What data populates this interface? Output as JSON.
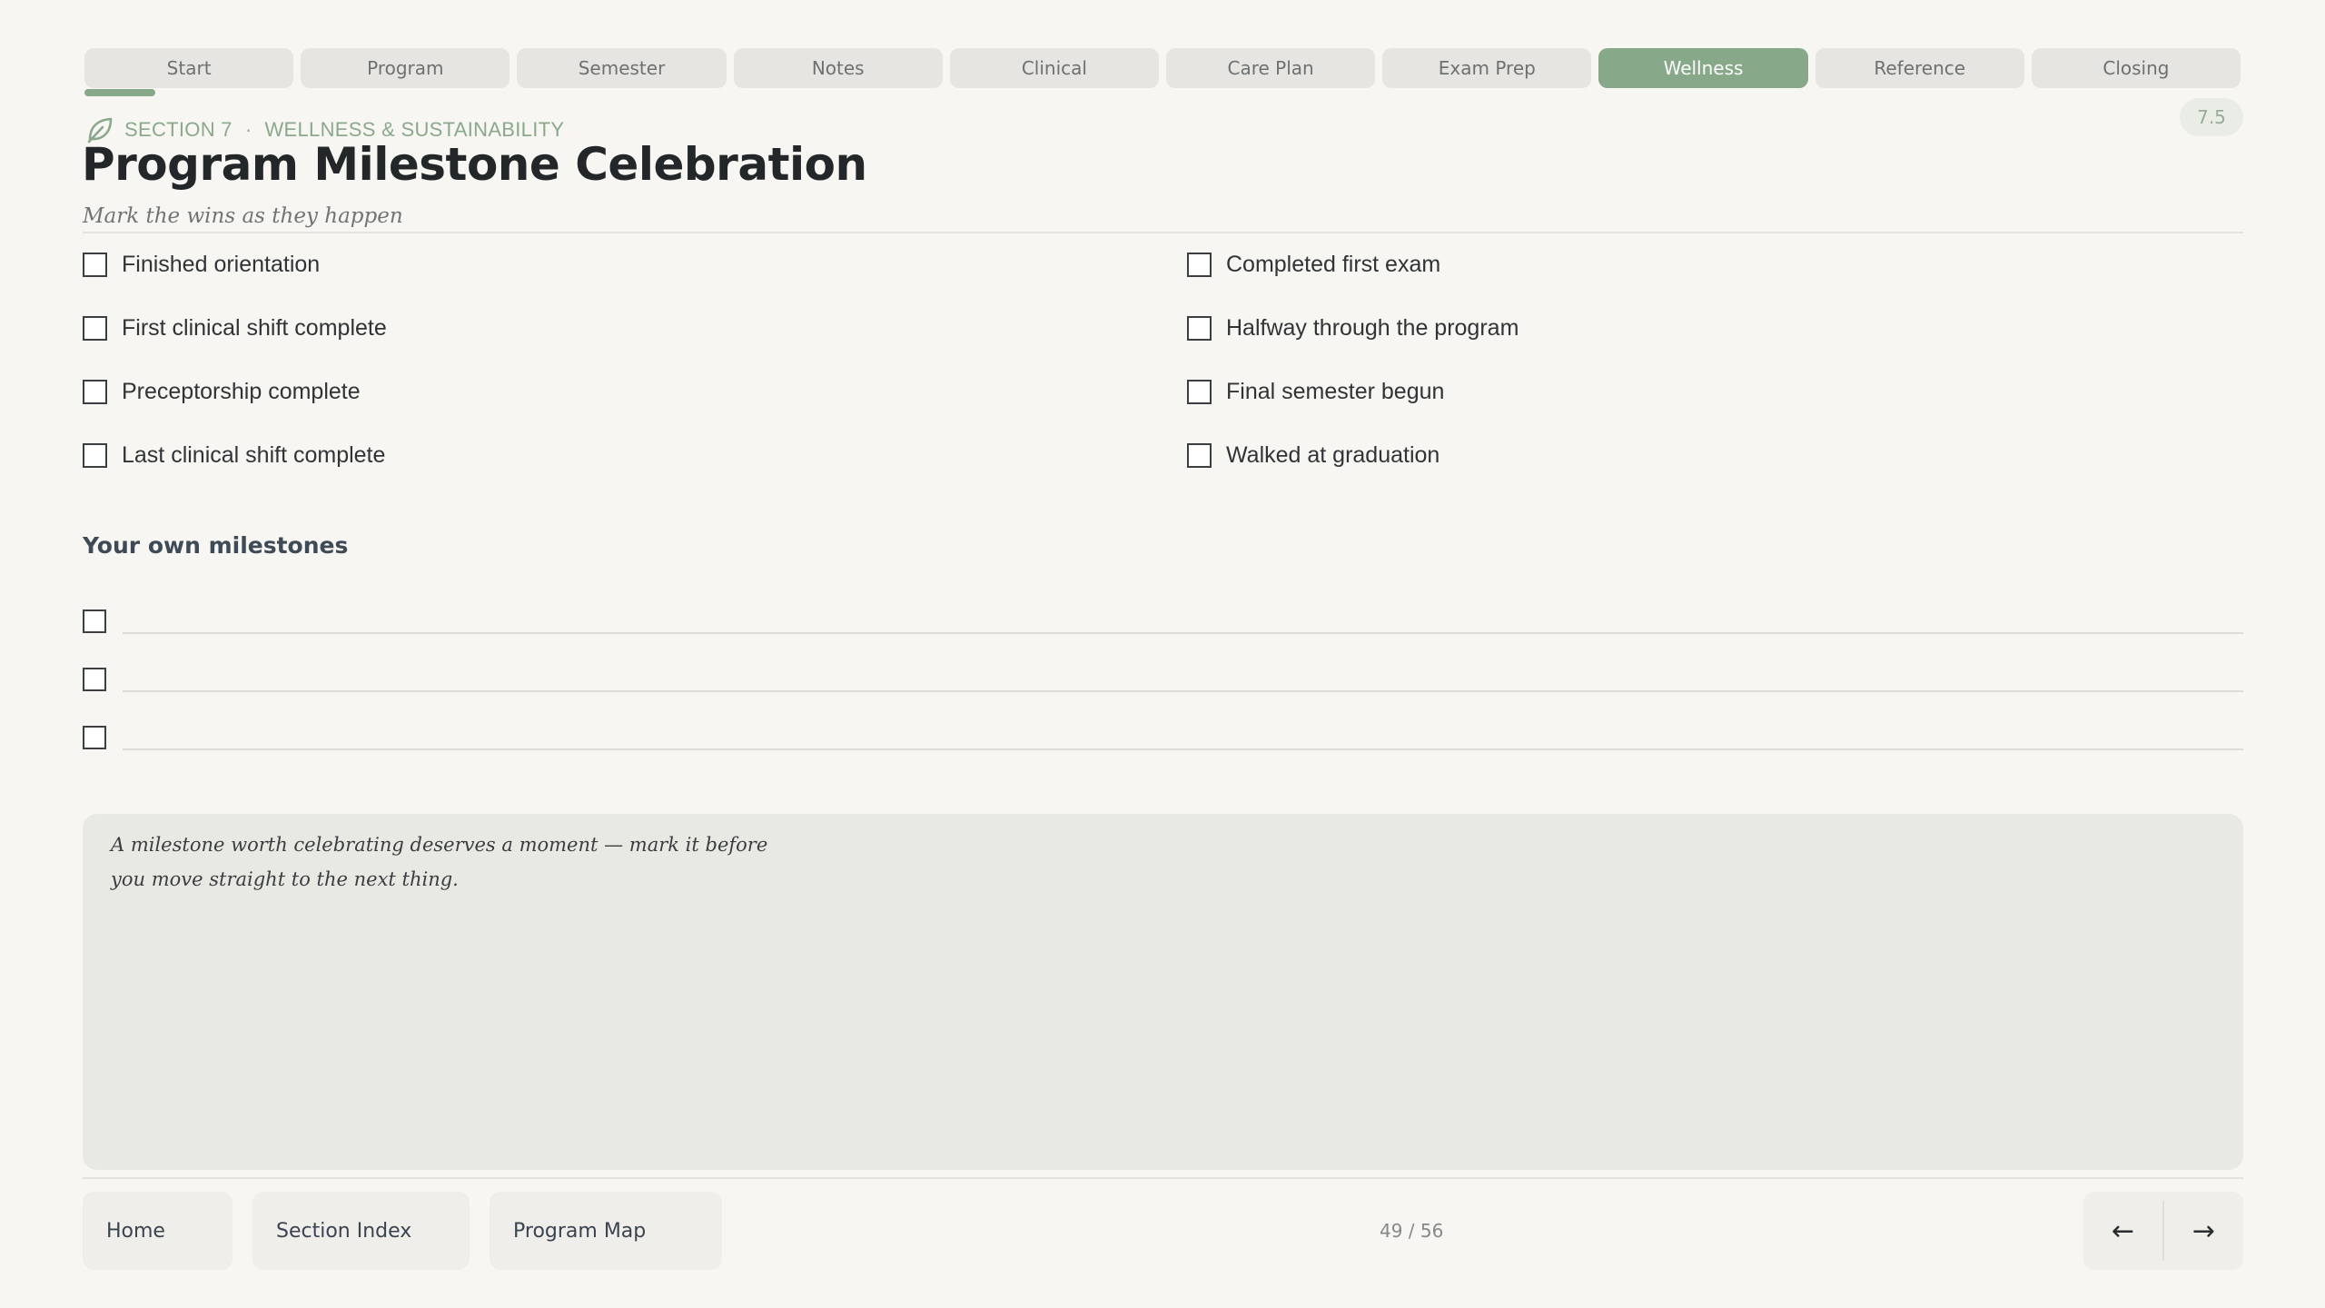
{
  "tabs": [
    {
      "label": "Start",
      "active": false
    },
    {
      "label": "Program",
      "active": false
    },
    {
      "label": "Semester",
      "active": false
    },
    {
      "label": "Notes",
      "active": false
    },
    {
      "label": "Clinical",
      "active": false
    },
    {
      "label": "Care Plan",
      "active": false
    },
    {
      "label": "Exam Prep",
      "active": false
    },
    {
      "label": "Wellness",
      "active": true
    },
    {
      "label": "Reference",
      "active": false
    },
    {
      "label": "Closing",
      "active": false
    }
  ],
  "header": {
    "icon": "leaf-icon",
    "section": "SECTION 7",
    "separator": "·",
    "section_name": "WELLNESS & SUSTAINABILITY",
    "page_badge": "7.5",
    "title": "Program Milestone Celebration",
    "subtitle": "Mark the wins as they happen"
  },
  "milestones": [
    {
      "label": "Finished orientation",
      "checked": false
    },
    {
      "label": "Completed first exam",
      "checked": false
    },
    {
      "label": "First clinical shift complete",
      "checked": false
    },
    {
      "label": "Halfway through the program",
      "checked": false
    },
    {
      "label": "Preceptorship complete",
      "checked": false
    },
    {
      "label": "Final semester begun",
      "checked": false
    },
    {
      "label": "Last clinical shift complete",
      "checked": false
    },
    {
      "label": "Walked at graduation",
      "checked": false
    }
  ],
  "own_milestones": {
    "heading": "Your own milestones",
    "rows": [
      "",
      "",
      ""
    ]
  },
  "note": {
    "text": "A milestone worth celebrating deserves a moment — mark it before you move straight to the next thing."
  },
  "footer": {
    "home": "Home",
    "section_index": "Section Index",
    "program_map": "Program Map",
    "page_count": "49 / 56",
    "prev_icon": "arrow-left-icon",
    "next_icon": "arrow-right-icon",
    "prev_glyph": "←",
    "next_glyph": "→"
  },
  "colors": {
    "accent": "#87a889",
    "background": "#f8f6f2",
    "tab_inactive": "#e6e5e1",
    "panel": "#e9e9e4"
  }
}
